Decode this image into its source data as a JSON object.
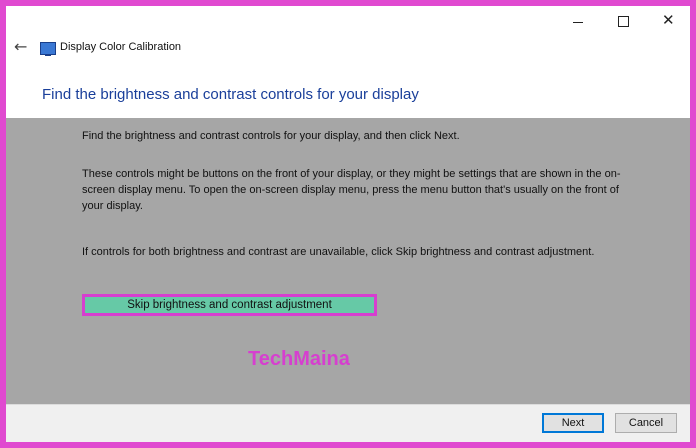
{
  "window": {
    "controls": {
      "minimize": "minimize",
      "maximize": "maximize",
      "close": "close"
    },
    "close_glyph": "✕"
  },
  "nav": {
    "back_glyph": "←",
    "app_title": "Display Color Calibration"
  },
  "page": {
    "heading": "Find the brightness and contrast controls for your display",
    "paragraphs": [
      "Find the brightness and contrast controls for your display, and then click Next.",
      "These controls might be buttons on the front of your display, or they might be settings that are shown in the on-screen display menu. To open the on-screen display menu, press the menu button that's usually on the front of your display.",
      "If controls for both brightness and contrast are unavailable, click Skip brightness and contrast adjustment."
    ],
    "skip_label": "Skip brightness and contrast adjustment",
    "watermark": "TechMaina"
  },
  "footer": {
    "next_label": "Next",
    "cancel_label": "Cancel"
  },
  "colors": {
    "border_highlight": "#d63fcf",
    "heading": "#1a3f9a",
    "content_bg": "#a6a6a6",
    "skip_bg": "#66c9a6"
  },
  "icons": [
    "back-arrow-icon",
    "display-calibration-icon",
    "minimize-icon",
    "maximize-icon",
    "close-icon"
  ]
}
